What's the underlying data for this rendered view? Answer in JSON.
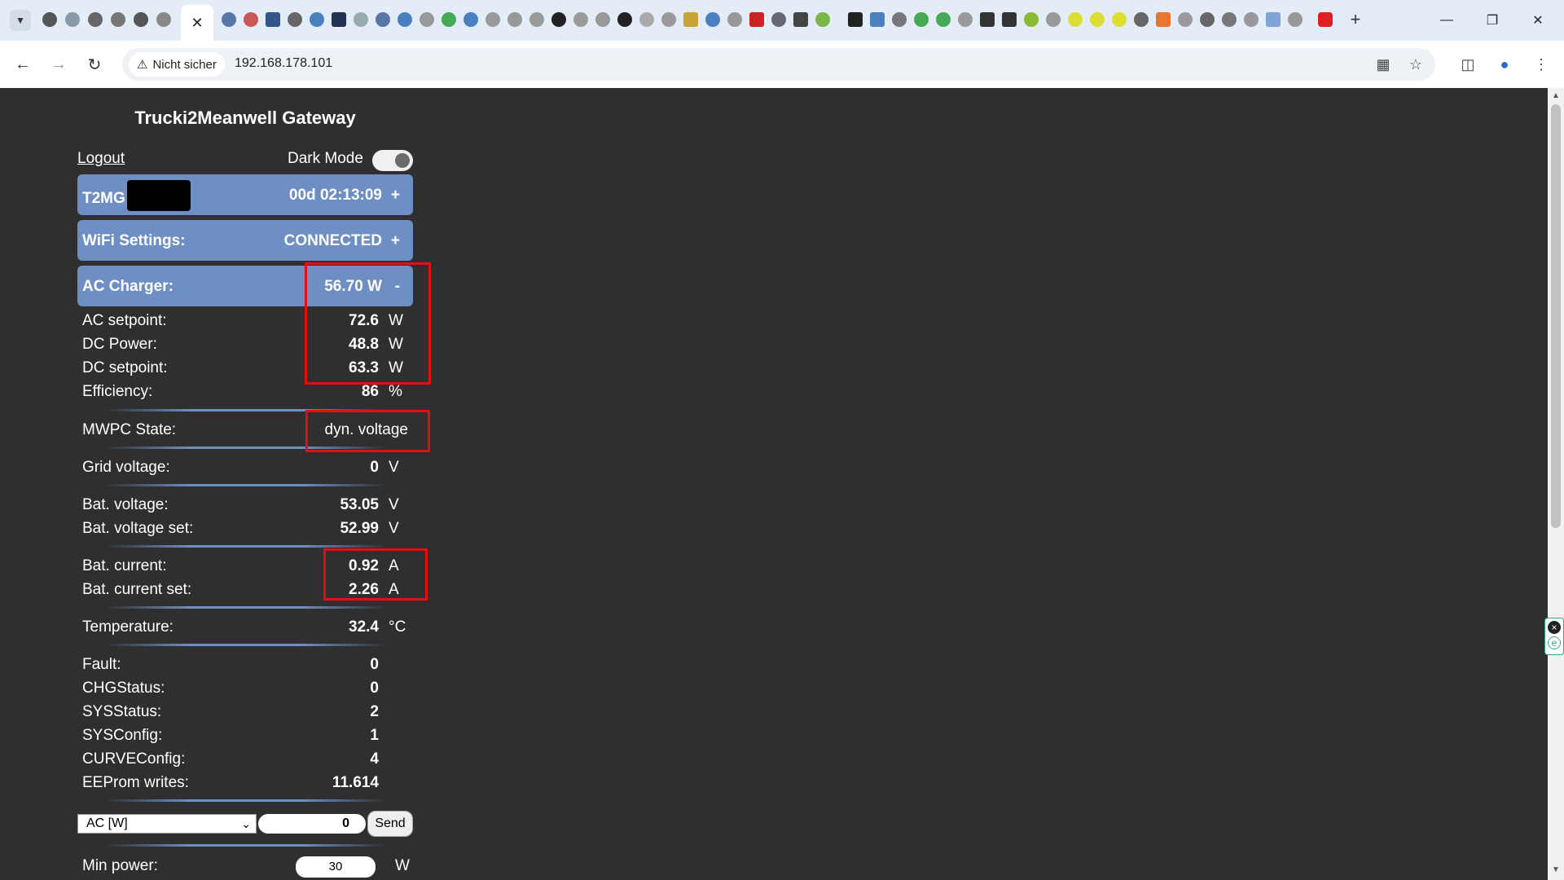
{
  "browser": {
    "security_label": "Nicht sicher",
    "url": "192.168.178.101",
    "active_tab_close": "✕",
    "new_tab": "+",
    "controls": {
      "minimize": "—",
      "restore": "❐",
      "close": "✕"
    }
  },
  "app": {
    "title": "Trucki2Meanwell Gateway",
    "logout": "Logout",
    "dark_mode_label": "Dark Mode",
    "dark_mode_on": true,
    "device": {
      "name": "T2MG",
      "uptime": "00d 02:13:09",
      "toggle": "+"
    },
    "wifi": {
      "label": "WiFi Settings:",
      "status": "CONNECTED",
      "toggle": "+"
    },
    "charger": {
      "label": "AC Charger:",
      "value": "56.70 W",
      "toggle": "-"
    },
    "power_rows": [
      {
        "label": "AC setpoint:",
        "value": "72.6",
        "unit": "W"
      },
      {
        "label": "DC Power:",
        "value": "48.8",
        "unit": "W"
      },
      {
        "label": "DC setpoint:",
        "value": "63.3",
        "unit": "W"
      },
      {
        "label": "Efficiency:",
        "value": "86",
        "unit": "%"
      }
    ],
    "mwpc": {
      "label": "MWPC State:",
      "value": "dyn. voltage"
    },
    "grid": {
      "label": "Grid voltage:",
      "value": "0",
      "unit": "V"
    },
    "bat_voltage": [
      {
        "label": "Bat. voltage:",
        "value": "53.05",
        "unit": "V"
      },
      {
        "label": "Bat. voltage set:",
        "value": "52.99",
        "unit": "V"
      }
    ],
    "bat_current": [
      {
        "label": "Bat. current:",
        "value": "0.92",
        "unit": "A"
      },
      {
        "label": "Bat. current set:",
        "value": "2.26",
        "unit": "A"
      }
    ],
    "temperature": {
      "label": "Temperature:",
      "value": "32.4",
      "unit": "°C"
    },
    "status_rows": [
      {
        "label": "Fault:",
        "value": "0"
      },
      {
        "label": "CHGStatus:",
        "value": "0"
      },
      {
        "label": "SYSStatus:",
        "value": "2"
      },
      {
        "label": "SYSConfig:",
        "value": "1"
      },
      {
        "label": "CURVEConfig:",
        "value": "4"
      },
      {
        "label": "EEProm writes:",
        "value": "11.614"
      }
    ],
    "command": {
      "select_value": "AC [W]",
      "input_value": "0",
      "send_label": "Send"
    },
    "min_power": {
      "label": "Min power:",
      "value": "30",
      "unit": "W"
    }
  }
}
